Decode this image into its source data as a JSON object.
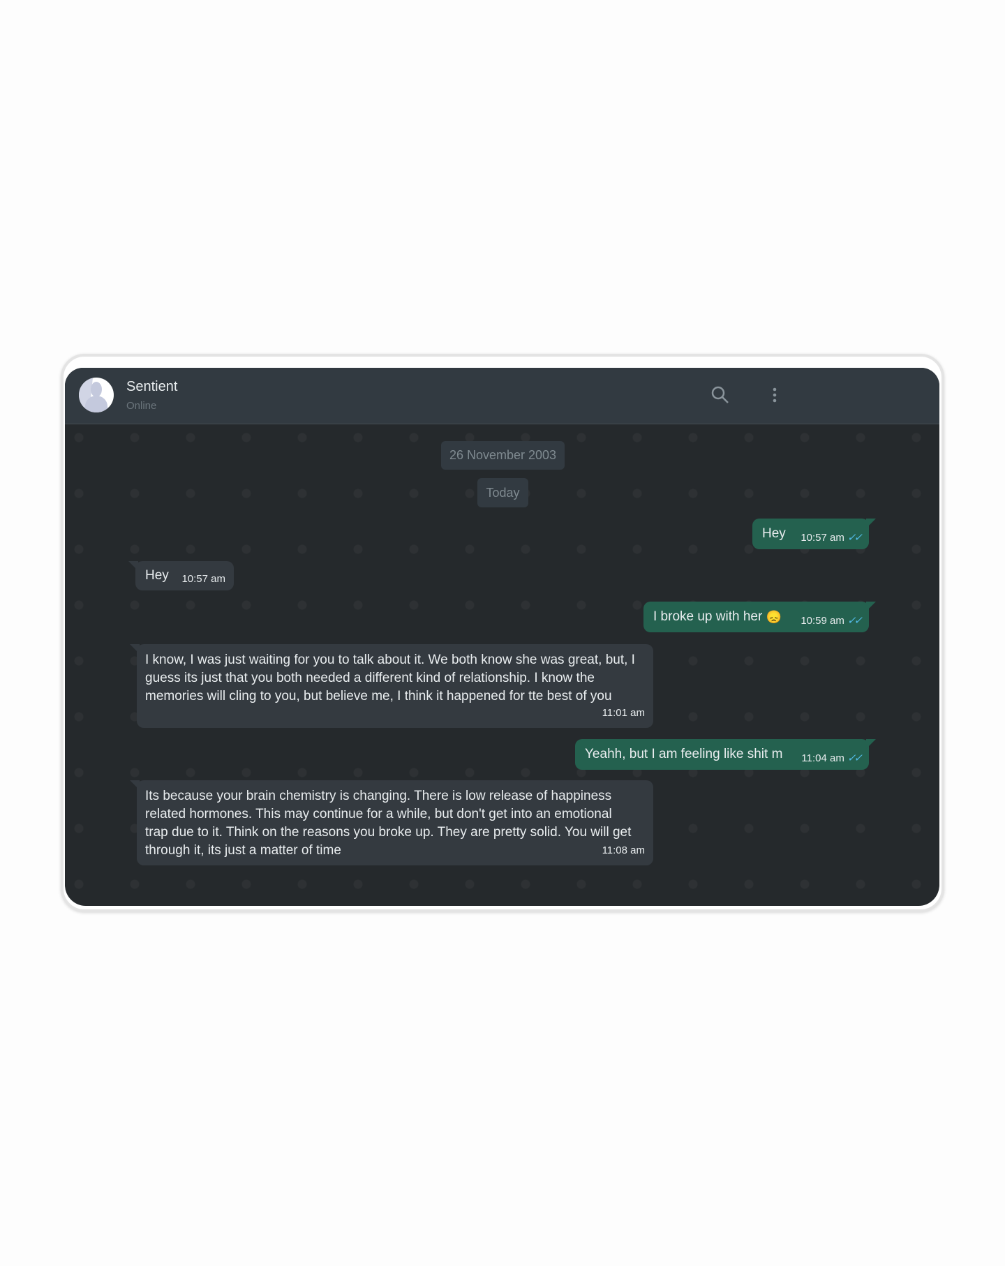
{
  "contact": {
    "name": "Sentient",
    "status": "Online"
  },
  "icons": {
    "search": "search-icon",
    "menu": "more-vertical-icon"
  },
  "chips": {
    "date": "26 November 2003",
    "today": "Today"
  },
  "messages": [
    {
      "direction": "out",
      "text": "Hey",
      "time": "10:57 am",
      "ticks": "✓✓"
    },
    {
      "direction": "in",
      "text": "Hey",
      "time": "10:57 am"
    },
    {
      "direction": "out",
      "text": "I broke up with her",
      "emoji": "😞",
      "time": "10:59 am",
      "ticks": "✓✓"
    },
    {
      "direction": "in",
      "text": "I know, I was just waiting for you to talk about it. We both know she was great, but, I guess its just that you both needed a different kind of relationship. I know the memories will cling to you, but believe me, I think it happened for tte best of you",
      "time": "11:01 am"
    },
    {
      "direction": "out",
      "text": "Yeahh, but I am feeling like shit m",
      "time": "11:04 am",
      "ticks": "✓✓"
    },
    {
      "direction": "in",
      "text": "Its because your brain chemistry is changing. There is low release of happiness related hormones. This may continue for a while, but don't get into an emotional trap due to it. Think on the reasons you broke up. They are pretty solid. You will get through it, its just a matter of time",
      "time": "11:08 am"
    }
  ],
  "colors": {
    "outgoing": "#24614f",
    "incoming": "#343a40",
    "header": "#323a41",
    "ticks": "#53bdeb"
  }
}
